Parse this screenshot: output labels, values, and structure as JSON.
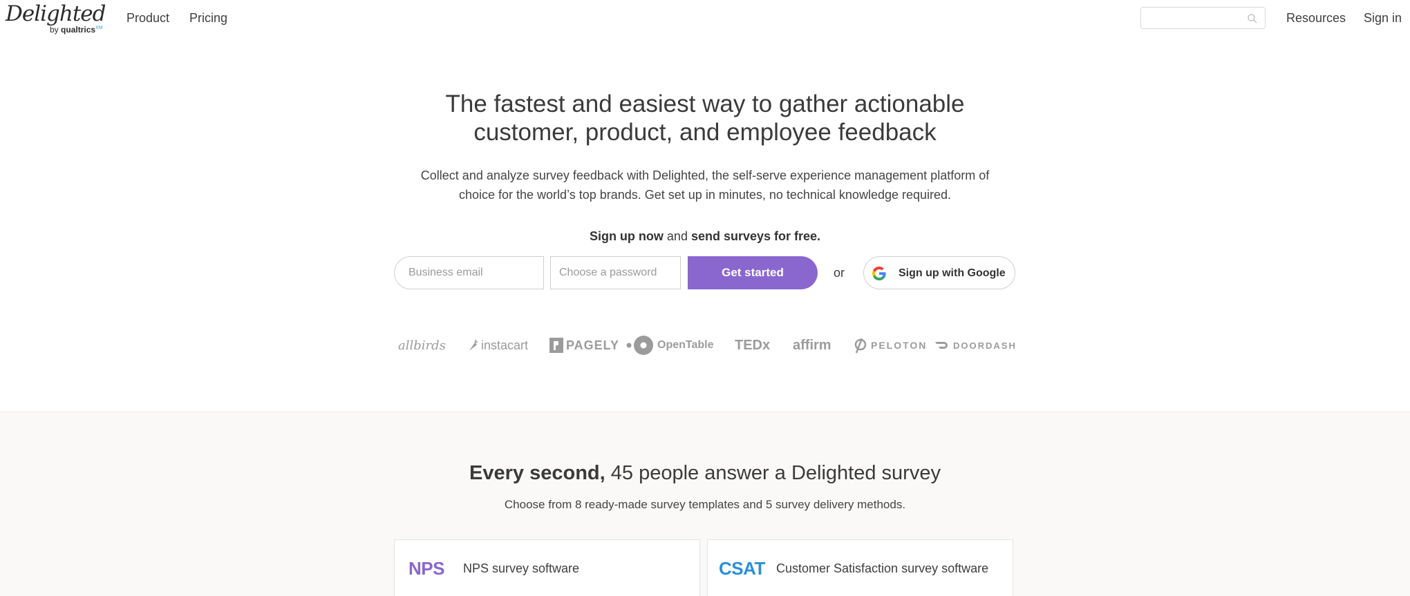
{
  "header": {
    "logo_main": "Delighted",
    "logo_by": "by",
    "logo_brand": "qualtrics",
    "logo_mark": "XM",
    "nav": [
      {
        "label": "Product"
      },
      {
        "label": "Pricing"
      }
    ],
    "search_placeholder": "",
    "resources": "Resources",
    "sign_in": "Sign in"
  },
  "hero": {
    "title_line1": "The fastest and easiest way to gather actionable",
    "title_line2": "customer, product, and employee feedback",
    "sub_line1": "Collect and analyze survey feedback with Delighted, the self-serve experience management platform of",
    "sub_line2": "choice for the world’s top brands. Get set up in minutes, no technical knowledge required.",
    "signup_now": "Sign up now",
    "signup_and": " and ",
    "signup_free": "send surveys for free."
  },
  "form": {
    "email_placeholder": "Business email",
    "password_placeholder": "Choose a password",
    "get_started": "Get started",
    "or": "or",
    "google": "Sign up with Google"
  },
  "brands": [
    "allbirds",
    "instacart",
    "PAGELY",
    "OpenTable",
    "TEDx",
    "affirm",
    "PELOTON",
    "DOORDASH"
  ],
  "lower": {
    "title_bold": "Every second,",
    "title_rest": " 45 people answer a Delighted survey",
    "sub": "Choose from 8 ready-made survey templates and 5 survey delivery methods.",
    "cards": [
      {
        "abbr": "NPS",
        "label": "NPS survey software",
        "color": "#8a67cf"
      },
      {
        "abbr": "CSAT",
        "label": "Customer Satisfaction survey software",
        "color": "#2a8fd8"
      }
    ]
  },
  "colors": {
    "accent_purple": "#8a67cf",
    "accent_blue": "#2a8fd8",
    "brand_gray": "#9b9b9b"
  }
}
